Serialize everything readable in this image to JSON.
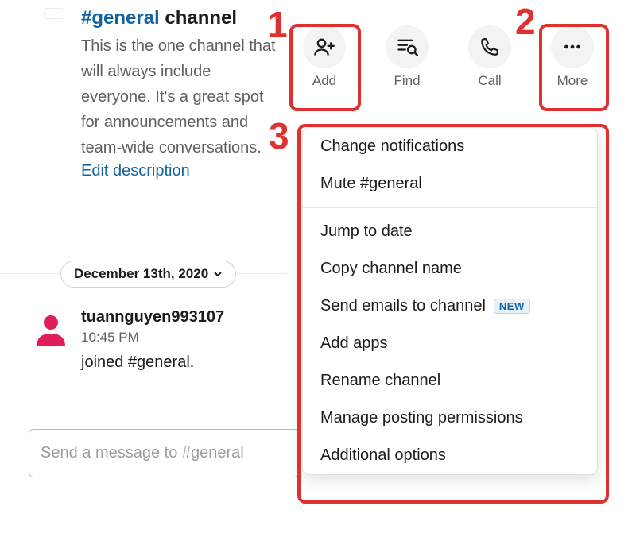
{
  "channel": {
    "name_link": "#general",
    "title_suffix": "channel",
    "description": "This is the one channel that will always include everyone. It's a great spot for announcements and team-wide conversations.",
    "edit_label": "Edit description"
  },
  "actions": {
    "add": {
      "label": "Add"
    },
    "find": {
      "label": "Find"
    },
    "call": {
      "label": "Call"
    },
    "more": {
      "label": "More"
    }
  },
  "date_divider": {
    "label": "December 13th, 2020"
  },
  "message": {
    "username": "tuannguyen993107",
    "time": "10:45 PM",
    "text": "joined #general."
  },
  "composer": {
    "placeholder": "Send a message to #general"
  },
  "menu": {
    "items_group1": [
      "Change notifications",
      "Mute #general"
    ],
    "items_group2": [
      "Jump to date",
      "Copy channel name",
      "Send emails to channel",
      "Add apps",
      "Rename channel",
      "Manage posting permissions",
      "Additional options"
    ],
    "new_badge": "NEW"
  },
  "annotations": {
    "1": "1",
    "2": "2",
    "3": "3"
  },
  "colors": {
    "accent": "#1264a3",
    "annotation": "#e03131",
    "avatar": "#e01e5a"
  }
}
